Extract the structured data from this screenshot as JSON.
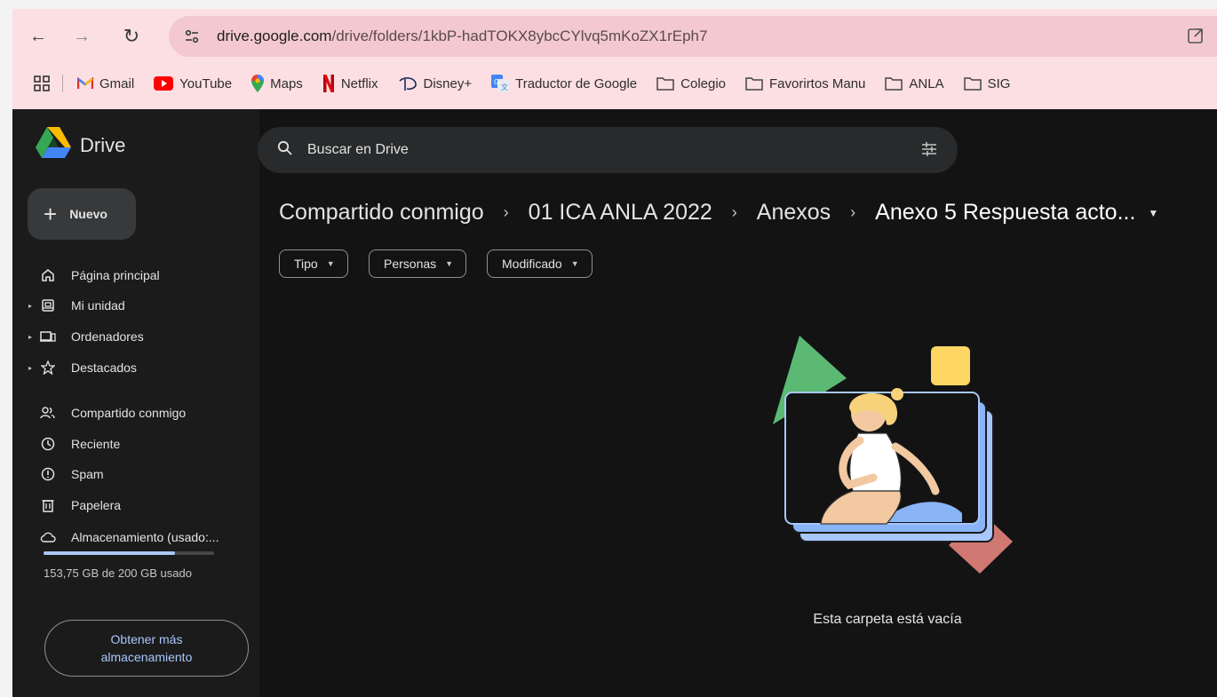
{
  "browser": {
    "url_domain": "drive.google.com",
    "url_path": "/drive/folders/1kbP-hadTOKX8ybcCYlvq5mKoZX1rEph7",
    "bookmarks": [
      {
        "label": "Gmail",
        "icon": "gmail-icon"
      },
      {
        "label": "YouTube",
        "icon": "youtube-icon"
      },
      {
        "label": "Maps",
        "icon": "maps-icon"
      },
      {
        "label": "Netflix",
        "icon": "netflix-icon"
      },
      {
        "label": "Disney+",
        "icon": "disney-icon"
      },
      {
        "label": "Traductor de Google",
        "icon": "translate-icon"
      },
      {
        "label": "Colegio",
        "icon": "folder-icon"
      },
      {
        "label": "Favorirtos Manu",
        "icon": "folder-icon"
      },
      {
        "label": "ANLA",
        "icon": "folder-icon"
      },
      {
        "label": "SIG",
        "icon": "folder-icon"
      }
    ]
  },
  "drive": {
    "logo_text": "Drive",
    "new_button": "Nuevo",
    "search_placeholder": "Buscar en Drive",
    "nav": [
      {
        "label": "Página principal",
        "icon": "home-icon",
        "expandable": false
      },
      {
        "label": "Mi unidad",
        "icon": "drive-icon",
        "expandable": true
      },
      {
        "label": "Ordenadores",
        "icon": "computer-icon",
        "expandable": true
      },
      {
        "label": "Destacados",
        "icon": "star-icon",
        "expandable": true
      },
      {
        "label": "Compartido conmigo",
        "icon": "people-icon",
        "expandable": false
      },
      {
        "label": "Reciente",
        "icon": "clock-icon",
        "expandable": false
      },
      {
        "label": "Spam",
        "icon": "spam-icon",
        "expandable": false
      },
      {
        "label": "Papelera",
        "icon": "trash-icon",
        "expandable": false
      },
      {
        "label": "Almacenamiento (usado:...",
        "icon": "cloud-icon",
        "expandable": false
      }
    ],
    "storage": {
      "used_fraction": 0.7688,
      "text": "153,75 GB de 200 GB usado",
      "button": "Obtener más almacenamiento"
    },
    "breadcrumb": [
      "Compartido conmigo",
      "01 ICA ANLA 2022",
      "Anexos",
      "Anexo 5 Respuesta acto..."
    ],
    "filters": [
      "Tipo",
      "Personas",
      "Modificado"
    ],
    "empty_message": "Esta carpeta está vacía"
  }
}
